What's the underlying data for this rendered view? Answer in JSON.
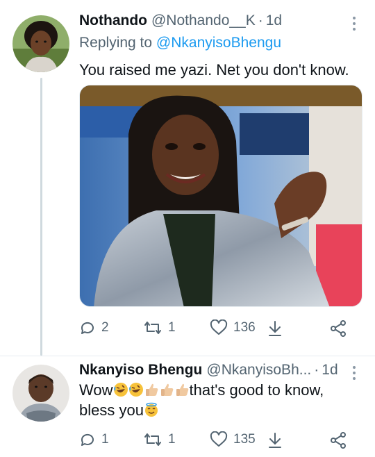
{
  "tweets": [
    {
      "name": "Nothando",
      "handle": "@Nothando__K",
      "separator": "·",
      "time": "1d",
      "replying_prefix": "Replying to ",
      "replying_to": "@NkanyisoBhengu",
      "text": "You raised me yazi. Net you don't know.",
      "counts": {
        "replies": "2",
        "retweets": "1",
        "likes": "136"
      }
    },
    {
      "name": "Nkanyiso Bhengu",
      "handle": "@NkanyisoBh...",
      "separator": "·",
      "time": "1d",
      "text_start": "Wow",
      "text_mid": "that's good to know,",
      "text_line2": "bless you",
      "counts": {
        "replies": "1",
        "retweets": "1",
        "likes": "135"
      }
    }
  ],
  "icons": [
    "avatar",
    "more-icon",
    "reply-icon",
    "retweet-icon",
    "like-icon",
    "download-icon",
    "share-icon",
    "rofl-emoji",
    "thumbs-up-emoji",
    "halo-emoji"
  ],
  "colors": {
    "accent": "#1d9bf0",
    "secondary_text": "#536471",
    "divider": "#e6ecf0"
  }
}
